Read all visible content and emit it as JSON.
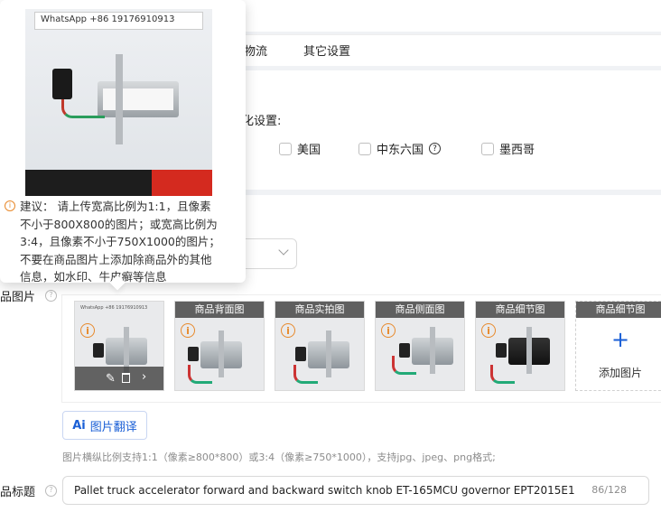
{
  "tabs": [
    {
      "label": "物流"
    },
    {
      "label": "其它设置"
    }
  ],
  "localization": {
    "label": "化设置:",
    "countries": [
      {
        "name": "美国"
      },
      {
        "name": "中东六国",
        "help_icon": "question-circle-icon"
      },
      {
        "name": "墨西哥"
      }
    ]
  },
  "tooltip": {
    "watermark": "WhatsApp +86 19176910913",
    "icon": "info-circle-icon",
    "lines": [
      "建议： 请上传宽高比例为1:1，且像素",
      "不小于800X800的图片；或宽高比例为",
      "3:4，且像素不小于750X1000的图片；",
      "不要在商品图片上添加除商品外的其他",
      "信息，如水印、牛皮癣等信息"
    ]
  },
  "images": {
    "label": "品图片",
    "main_thumb_watermark": "WhatsApp +86 19176910913",
    "slots": [
      {
        "caption": "商品背面图"
      },
      {
        "caption": "商品实拍图"
      },
      {
        "caption": "商品侧面图"
      },
      {
        "caption": "商品细节图"
      }
    ],
    "add_slot": {
      "caption": "商品细节图",
      "plus": "+",
      "label": "添加图片"
    },
    "translate_button": {
      "ai": "Ai",
      "label": "图片翻译"
    },
    "hint": "图片横纵比例支持1:1（像素≥800*800）或3:4（像素≥750*1000），支持jpg、jpeg、png格式;"
  },
  "title_field": {
    "label": "品标题",
    "value": "Pallet truck accelerator forward and backward switch knob ET-165MCU governor EPT2015E1",
    "counter": "86/128"
  },
  "colors": {
    "accent": "#1a5fd6",
    "warning": "#e8892b",
    "background": "#f0f2f5"
  }
}
